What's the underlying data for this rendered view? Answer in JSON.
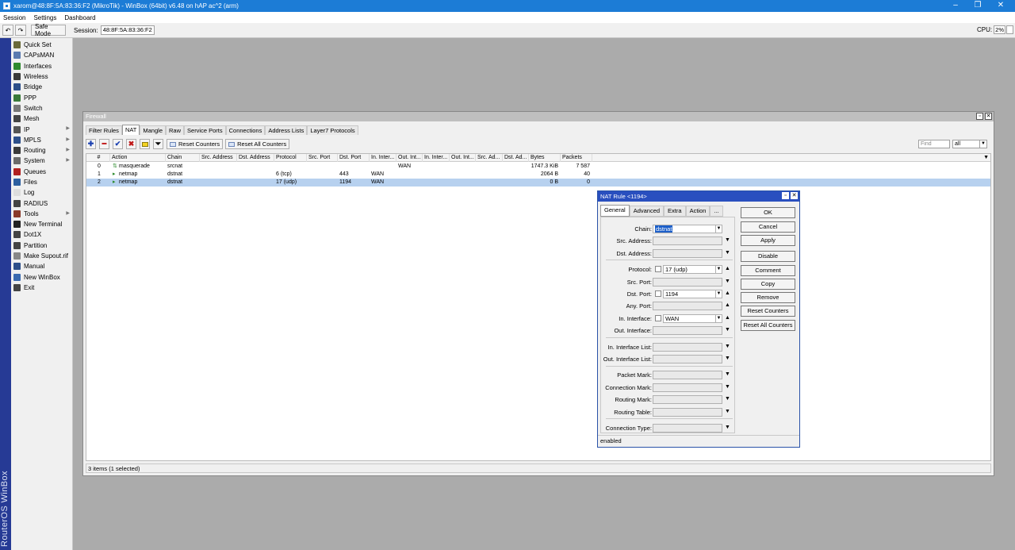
{
  "window": {
    "title": "xarom@48:8F:5A:83:36:F2 (MikroTik) - WinBox (64bit) v6.48 on hAP ac^2 (arm)",
    "controls": [
      "–",
      "❐",
      "✕"
    ]
  },
  "menu": [
    "Session",
    "Settings",
    "Dashboard"
  ],
  "toolbar": {
    "undo": "↶",
    "redo": "↷",
    "safe_mode": "Safe Mode",
    "session_label": "Session:",
    "session_value": "48:8F:5A:83:36:F2",
    "cpu_label": "CPU:",
    "cpu_value": "2%"
  },
  "sidebar": {
    "brand": "RouterOS WinBox",
    "items": [
      {
        "label": "Quick Set",
        "icon": "quick-set-icon",
        "color": "#6a6a3a",
        "submenu": false
      },
      {
        "label": "CAPsMAN",
        "icon": "capsman-icon",
        "color": "#5a7ab0",
        "submenu": false
      },
      {
        "label": "Interfaces",
        "icon": "interfaces-icon",
        "color": "#2f8a2f",
        "submenu": false
      },
      {
        "label": "Wireless",
        "icon": "wireless-icon",
        "color": "#3a3a3a",
        "submenu": false
      },
      {
        "label": "Bridge",
        "icon": "bridge-icon",
        "color": "#2d4f8a",
        "submenu": false
      },
      {
        "label": "PPP",
        "icon": "ppp-icon",
        "color": "#3a7a3a",
        "submenu": false
      },
      {
        "label": "Switch",
        "icon": "switch-icon",
        "color": "#777777",
        "submenu": false
      },
      {
        "label": "Mesh",
        "icon": "mesh-icon",
        "color": "#444444",
        "submenu": false
      },
      {
        "label": "IP",
        "icon": "ip-icon",
        "color": "#555555",
        "submenu": true
      },
      {
        "label": "MPLS",
        "icon": "mpls-icon",
        "color": "#2d4f8a",
        "submenu": true
      },
      {
        "label": "Routing",
        "icon": "routing-icon",
        "color": "#3a3a3a",
        "submenu": true
      },
      {
        "label": "System",
        "icon": "system-icon",
        "color": "#6a6a6a",
        "submenu": true
      },
      {
        "label": "Queues",
        "icon": "queues-icon",
        "color": "#b02020",
        "submenu": false
      },
      {
        "label": "Files",
        "icon": "files-icon",
        "color": "#2d5fa0",
        "submenu": false
      },
      {
        "label": "Log",
        "icon": "log-icon",
        "color": "#dddddd",
        "submenu": false
      },
      {
        "label": "RADIUS",
        "icon": "radius-icon",
        "color": "#444444",
        "submenu": false
      },
      {
        "label": "Tools",
        "icon": "tools-icon",
        "color": "#8a3a2a",
        "submenu": true
      },
      {
        "label": "New Terminal",
        "icon": "terminal-icon",
        "color": "#222222",
        "submenu": false
      },
      {
        "label": "Dot1X",
        "icon": "dot1x-icon",
        "color": "#444444",
        "submenu": false
      },
      {
        "label": "Partition",
        "icon": "partition-icon",
        "color": "#444444",
        "submenu": false
      },
      {
        "label": "Make Supout.rif",
        "icon": "supout-icon",
        "color": "#888888",
        "submenu": false
      },
      {
        "label": "Manual",
        "icon": "manual-icon",
        "color": "#2d4f8a",
        "submenu": false
      },
      {
        "label": "New WinBox",
        "icon": "winbox-icon",
        "color": "#3a6ab0",
        "submenu": false
      },
      {
        "label": "Exit",
        "icon": "exit-icon",
        "color": "#444444",
        "submenu": false
      }
    ]
  },
  "firewall": {
    "title": "Firewall",
    "tabs": [
      "Filter Rules",
      "NAT",
      "Mangle",
      "Raw",
      "Service Ports",
      "Connections",
      "Address Lists",
      "Layer7 Protocols"
    ],
    "active_tab": "NAT",
    "buttons": {
      "reset_counters": "Reset Counters",
      "reset_all_counters": "Reset All Counters"
    },
    "find_placeholder": "Find",
    "filter_value": "all",
    "columns": [
      "#",
      "Action",
      "Chain",
      "Src. Address",
      "Dst. Address",
      "Protocol",
      "Src. Port",
      "Dst. Port",
      "In. Inter...",
      "Out. Int...",
      "In. Inter...",
      "Out. Int...",
      "Src. Ad...",
      "Dst. Ad...",
      "Bytes",
      "Packets"
    ],
    "rows": [
      {
        "num": "0",
        "action": "masquerade",
        "chain": "srcnat",
        "protocol": "",
        "dst_port": "",
        "in_iface": "",
        "out_iface": "WAN",
        "bytes": "1747.3 KiB",
        "packets": "7 587",
        "selected": false
      },
      {
        "num": "1",
        "action": "netmap",
        "chain": "dstnat",
        "protocol": "6 (tcp)",
        "dst_port": "443",
        "in_iface": "WAN",
        "out_iface": "",
        "bytes": "2064 B",
        "packets": "40",
        "selected": false
      },
      {
        "num": "2",
        "action": "netmap",
        "chain": "dstnat",
        "protocol": "17 (udp)",
        "dst_port": "1194",
        "in_iface": "WAN",
        "out_iface": "",
        "bytes": "0 B",
        "packets": "0",
        "selected": true
      }
    ],
    "status": "3 items (1 selected)"
  },
  "nat_rule": {
    "title": "NAT Rule <1194>",
    "tabs": [
      "General",
      "Advanced",
      "Extra",
      "Action",
      "..."
    ],
    "active_tab": "General",
    "fields": {
      "chain": {
        "label": "Chain:",
        "value": "dstnat"
      },
      "src_address": {
        "label": "Src. Address:",
        "value": ""
      },
      "dst_address": {
        "label": "Dst. Address:",
        "value": ""
      },
      "protocol": {
        "label": "Protocol:",
        "value": "17 (udp)"
      },
      "src_port": {
        "label": "Src. Port:",
        "value": ""
      },
      "dst_port": {
        "label": "Dst. Port:",
        "value": "1194"
      },
      "any_port": {
        "label": "Any. Port:",
        "value": ""
      },
      "in_interface": {
        "label": "In. Interface:",
        "value": "WAN"
      },
      "out_interface": {
        "label": "Out. Interface:",
        "value": ""
      },
      "in_interface_list": {
        "label": "In. Interface List:",
        "value": ""
      },
      "out_interface_list": {
        "label": "Out. Interface List:",
        "value": ""
      },
      "packet_mark": {
        "label": "Packet Mark:",
        "value": ""
      },
      "connection_mark": {
        "label": "Connection Mark:",
        "value": ""
      },
      "routing_mark": {
        "label": "Routing Mark:",
        "value": ""
      },
      "routing_table": {
        "label": "Routing Table:",
        "value": ""
      },
      "connection_type": {
        "label": "Connection Type:",
        "value": ""
      }
    },
    "buttons": {
      "ok": "OK",
      "cancel": "Cancel",
      "apply": "Apply",
      "disable": "Disable",
      "comment": "Comment",
      "copy": "Copy",
      "remove": "Remove",
      "reset_counters": "Reset Counters",
      "reset_all_counters": "Reset All Counters"
    },
    "status": "enabled"
  }
}
